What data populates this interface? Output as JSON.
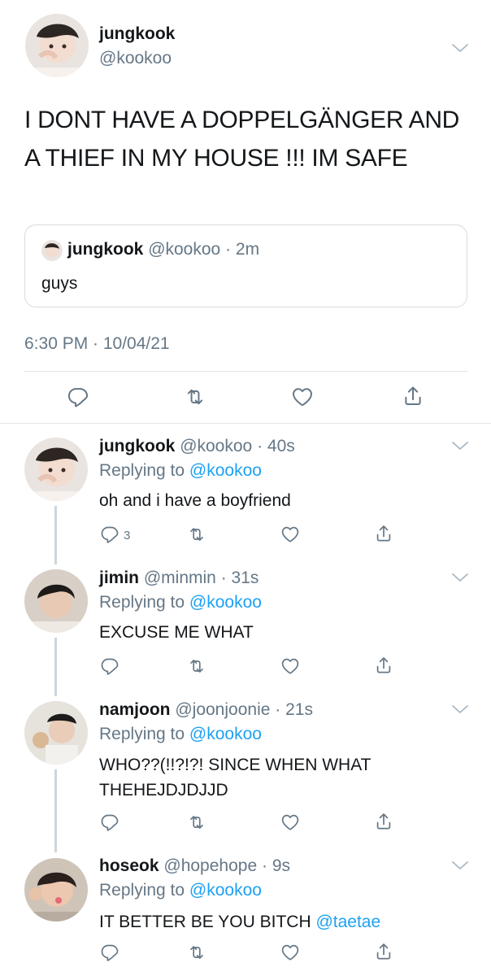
{
  "main_tweet": {
    "name": "jungkook",
    "handle": "@kookoo",
    "text": "I DONT HAVE A DOPPELGÄNGER AND A THIEF IN MY HOUSE !!! IM SAFE",
    "quote": {
      "name": "jungkook",
      "handle": "@kookoo",
      "time": "2m",
      "text": "guys"
    },
    "timestamp": "6:30 PM · 10/04/21"
  },
  "replies": [
    {
      "name": "jungkook",
      "handle": "@kookoo",
      "time": "40s",
      "replying_label": "Replying to",
      "replying_to": "@kookoo",
      "text": "oh and i have a boyfriend",
      "reply_count": "3"
    },
    {
      "name": "jimin",
      "handle": "@minmin",
      "time": "31s",
      "replying_label": "Replying to",
      "replying_to": "@kookoo",
      "text": "EXCUSE ME WHAT"
    },
    {
      "name": "namjoon",
      "handle": "@joonjoonie",
      "time": "21s",
      "replying_label": "Replying to",
      "replying_to": "@kookoo",
      "text": "WHO??(!!?!?! SINCE WHEN WHAT THEHEJDJDJJD"
    },
    {
      "name": "hoseok",
      "handle": "@hopehope",
      "time": "9s",
      "replying_label": "Replying to",
      "replying_to": "@kookoo",
      "text": "IT BETTER BE YOU BITCH",
      "mention": "@taetae"
    }
  ],
  "colors": {
    "link": "#1da1f2",
    "muted": "#657786",
    "divider": "#e1e6ea"
  },
  "icons": [
    "reply-icon",
    "retweet-icon",
    "like-icon",
    "share-icon",
    "chevron-down-icon"
  ]
}
